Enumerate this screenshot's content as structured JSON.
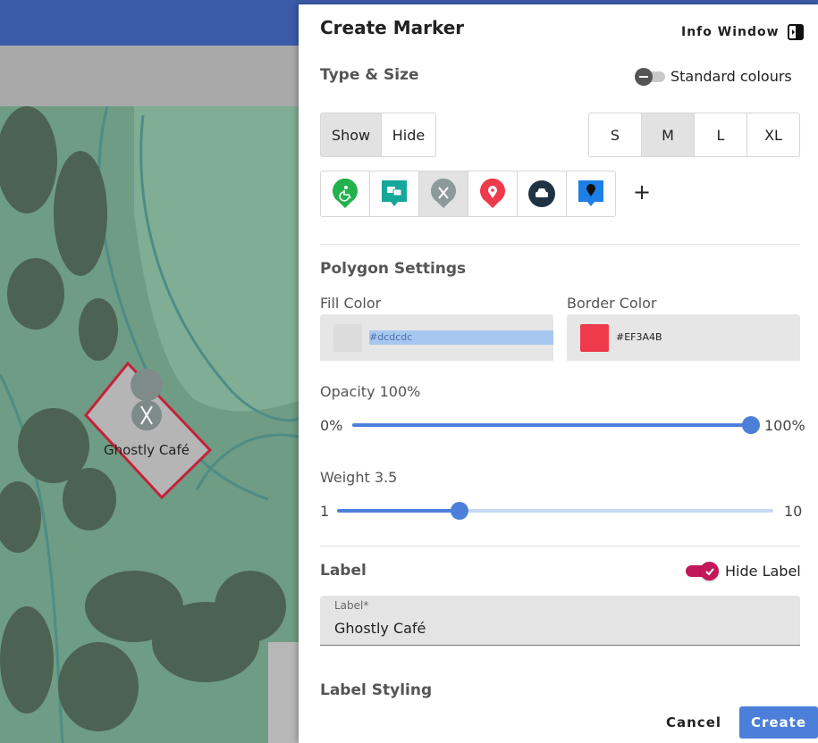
{
  "panel": {
    "title": "Create Marker",
    "info_window": "Info Window"
  },
  "type_size": {
    "heading": "Type & Size",
    "toggle_label": "Standard colours",
    "visibility": [
      "Show",
      "Hide"
    ],
    "visibility_selected": "Show",
    "sizes": [
      "S",
      "M",
      "L",
      "XL"
    ],
    "size_selected": "M",
    "marker_icons": [
      {
        "name": "accessible-marker-icon",
        "color": "#22b14c"
      },
      {
        "name": "chat-marker-icon",
        "color": "#16a79a"
      },
      {
        "name": "utensils-marker-icon",
        "color": "#8c9a9a",
        "selected": true
      },
      {
        "name": "location-pin-marker-icon",
        "color": "#ef3a4b"
      },
      {
        "name": "car-marker-icon",
        "color": "#1f3344"
      },
      {
        "name": "pin-marker-icon",
        "color": "#1d7fe8"
      }
    ],
    "add_label": "+"
  },
  "polygon": {
    "heading": "Polygon Settings",
    "fill_label": "Fill Color",
    "fill_value": "#dcdcdc",
    "border_label": "Border Color",
    "border_value": "#EF3A4B",
    "opacity_label": "Opacity 100%",
    "opacity_min": "0%",
    "opacity_max": "100%",
    "opacity_level": 1.0,
    "weight_label": "Weight 3.5",
    "weight_min": "1",
    "weight_max": "10",
    "weight_level": 0.28
  },
  "label": {
    "heading": "Label",
    "toggle_label": "Hide Label",
    "field_label": "Label*",
    "field_value": "Ghostly Café"
  },
  "label_styling": {
    "heading": "Label Styling"
  },
  "footer": {
    "cancel": "Cancel",
    "create": "Create"
  },
  "map": {
    "marker_label": "Ghostly Café"
  },
  "colors": {
    "accent": "#4c7fd9",
    "toggle_on": "#c2185b",
    "border_color": "#EF3A4B"
  }
}
